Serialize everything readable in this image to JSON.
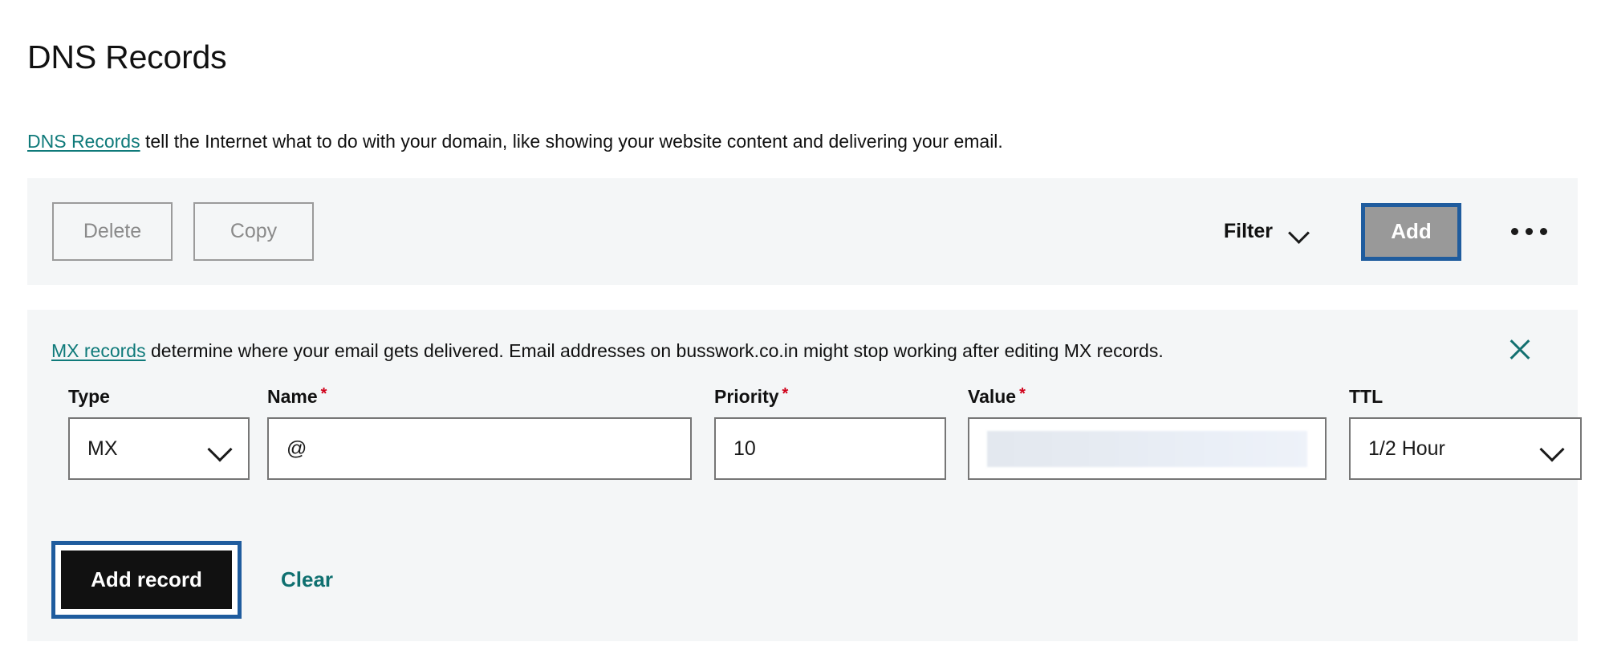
{
  "page": {
    "title": "DNS Records",
    "description_link": "DNS Records",
    "description_rest": " tell the Internet what to do with your domain, like showing your website content and delivering your email."
  },
  "toolbar": {
    "delete_label": "Delete",
    "copy_label": "Copy",
    "filter_label": "Filter",
    "add_label": "Add",
    "more_label": "•••",
    "accent_focus_color": "#1f5c9e",
    "add_button_color": "#999999"
  },
  "notice": {
    "link": "MX records",
    "text": " determine where your email gets delivered. Email addresses on busswork.co.in might stop working after editing MX records.",
    "domain": "busswork.co.in",
    "close_label": "Close",
    "link_color": "#137070"
  },
  "form": {
    "fields": [
      {
        "label": "Type",
        "required": false,
        "kind": "select",
        "value": "MX"
      },
      {
        "label": "Name",
        "required": true,
        "kind": "input",
        "value": "@"
      },
      {
        "label": "Priority",
        "required": true,
        "kind": "input",
        "value": "10"
      },
      {
        "label": "Value",
        "required": true,
        "kind": "redacted",
        "value": ""
      },
      {
        "label": "TTL",
        "required": false,
        "kind": "select",
        "value": "1/2 Hour"
      }
    ],
    "required_marker": "*",
    "required_color": "#d0021b",
    "submit_label": "Add record",
    "clear_label": "Clear",
    "clear_color": "#0f7070"
  }
}
